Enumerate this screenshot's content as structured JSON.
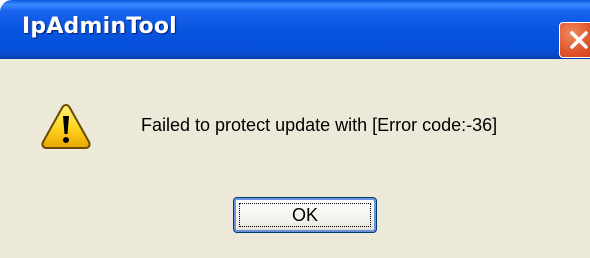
{
  "window": {
    "title": "IpAdminTool",
    "close_icon": "close-icon"
  },
  "dialog": {
    "icon": "warning-icon",
    "message": "Failed to protect update with [Error code:-36]",
    "ok_label": "OK"
  },
  "colors": {
    "titlebar": "#0a57e2",
    "body": "#ece9d8",
    "close_button": "#e0542a",
    "warning_fill": "#ffd21e"
  }
}
